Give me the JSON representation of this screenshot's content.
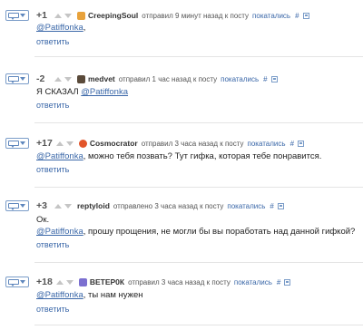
{
  "comments": [
    {
      "score": "+1",
      "user": "CreepingSoul",
      "posted": "отправил 9 минут назад к посту",
      "show_link": "покатались",
      "hash": "#",
      "lines": [
        {
          "mention": "@Patiffonka",
          "text": ","
        }
      ],
      "reply": "ответить",
      "avatar_color": "#e8a23b"
    },
    {
      "score": "-2",
      "user": "medvet",
      "posted": "отправил 1 час назад к посту",
      "show_link": "покатались",
      "hash": "#",
      "lines": [
        {
          "prefix": "Я СКАЗАЛ ",
          "mention": "@Patiffonka",
          "text": ""
        }
      ],
      "reply": "ответить",
      "avatar_color": "#5a4a3a"
    },
    {
      "score": "+17",
      "user": "Cosmocrator",
      "posted": "отправил 3 часа назад к посту",
      "show_link": "покатались",
      "hash": "#",
      "lines": [
        {
          "mention": "@Patiffonka",
          "text": ", можно тебя позвать? Тут гифка, которая тебе понравится."
        }
      ],
      "reply": "ответить",
      "avatar_color": "#e2552a"
    },
    {
      "score": "+3",
      "user": "reptyloid",
      "posted": "отправлено 3 часа назад к посту",
      "show_link": "покатались",
      "hash": "#",
      "lines": [
        {
          "prefix": "Ок.",
          "mention": "",
          "text": ""
        },
        {
          "mention": "@Patiffonka",
          "text": ", прошу прощения, не могли бы вы поработать над данной гифкой?"
        }
      ],
      "reply": "ответить",
      "avatar_color": ""
    },
    {
      "score": "+18",
      "user": "ВЕТЕР0К",
      "posted": "отправил 3 часа назад к посту",
      "show_link": "покатались",
      "hash": "#",
      "lines": [
        {
          "mention": "@Patiffonka",
          "text": ", ты нам нужен"
        }
      ],
      "reply": "ответить",
      "avatar_color": "#7b6fd0"
    }
  ]
}
